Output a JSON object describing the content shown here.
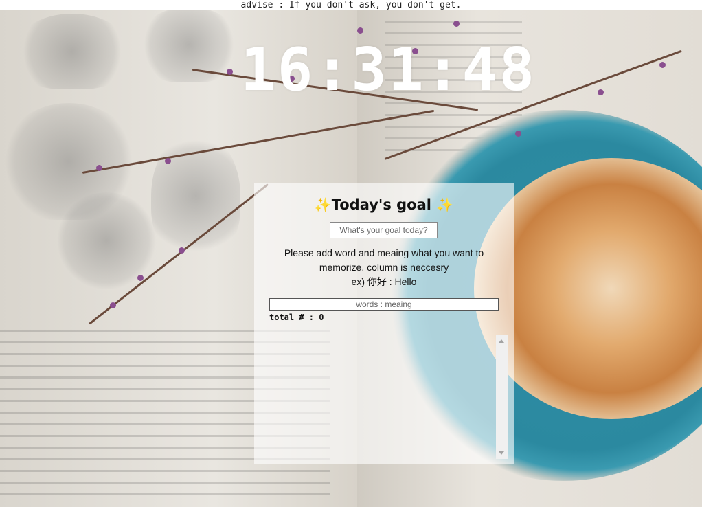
{
  "advise": {
    "text": "advise : If you don't ask, you don't get."
  },
  "clock": {
    "time": "16:31:48"
  },
  "goal": {
    "spark_left": "✨",
    "title": "Today's goal",
    "spark_right": "✨",
    "input_placeholder": "What's your goal today?",
    "instruction_line1": "Please add word and meaing what you want to memorize. column is neccesry",
    "instruction_line2": "ex) 你好 : Hello",
    "words_placeholder": "words : meaing",
    "total_label": "total # : 0"
  }
}
